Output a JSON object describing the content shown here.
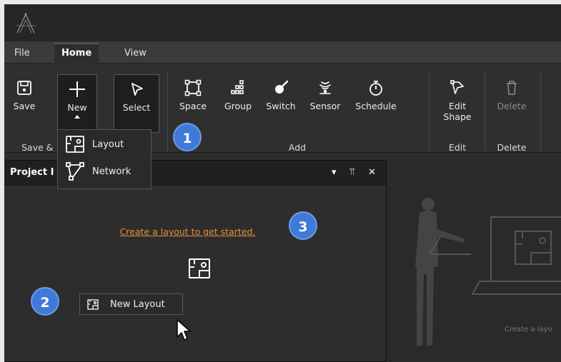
{
  "menu": {
    "tabs": [
      {
        "label": "File"
      },
      {
        "label": "Home"
      },
      {
        "label": "View"
      }
    ],
    "active_tab": "Home"
  },
  "ribbon": {
    "buttons": {
      "save": "Save",
      "new": "New",
      "select": "Select",
      "space": "Space",
      "group": "Group",
      "switch": "Switch",
      "sensor": "Sensor",
      "schedule": "Schedule",
      "edit_shape": "Edit\nShape",
      "delete": "Delete"
    },
    "groups": {
      "save": "Save &",
      "add": "Add",
      "edit": "Edit",
      "delete": "Delete"
    }
  },
  "new_dropdown": {
    "items": [
      {
        "label": "Layout",
        "icon": "layout-icon"
      },
      {
        "label": "Network",
        "icon": "network-icon"
      }
    ]
  },
  "panel": {
    "title": "Project I",
    "controls": {
      "dropdown": "▾",
      "pin": "⫪",
      "close": "✕"
    },
    "create_link": "Create a layout to get started.",
    "new_layout_button": "New Layout"
  },
  "callouts": {
    "one": "1",
    "two": "2",
    "three": "3"
  },
  "illustration": {
    "caption": "Create a layo"
  },
  "colors": {
    "accent_link": "#e6903a",
    "callout": "#3f7ad8",
    "background": "#2d2d2d"
  }
}
